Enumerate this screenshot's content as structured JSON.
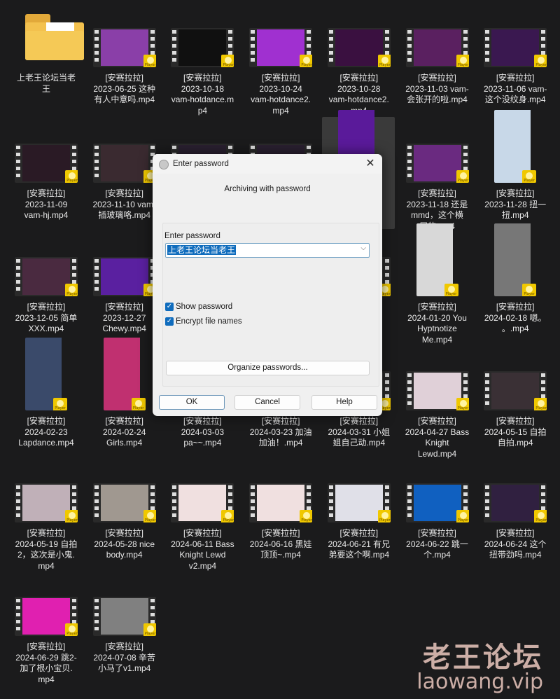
{
  "explorer": {
    "items": [
      {
        "type": "folder",
        "lines": [
          "上老王论坛当老",
          "王"
        ]
      },
      {
        "type": "video",
        "lines": [
          "[安赛拉拉]",
          "2023-06-25 这种",
          "有人中意吗.mp4"
        ],
        "color": "#8a3fa8"
      },
      {
        "type": "video",
        "lines": [
          "[安赛拉拉]",
          "2023-10-18",
          "vam-hotdance.m",
          "p4"
        ],
        "color": "#101010"
      },
      {
        "type": "video",
        "lines": [
          "[安赛拉拉]",
          "2023-10-24",
          "vam-hotdance2.",
          "mp4"
        ],
        "color": "#a030d0"
      },
      {
        "type": "video",
        "lines": [
          "[安赛拉拉]",
          "2023-10-28",
          "vam-hotdance2.",
          "mp4"
        ],
        "color": "#3a1040"
      },
      {
        "type": "video",
        "lines": [
          "[安赛拉拉]",
          "2023-11-03 vam-",
          "会张开的啦.mp4"
        ],
        "color": "#5a2060"
      },
      {
        "type": "video",
        "lines": [
          "[安赛拉拉]",
          "2023-11-06 vam-",
          "这个没纹身.mp4"
        ],
        "color": "#3a1850"
      },
      {
        "type": "video",
        "lines": [
          "[安赛拉拉]",
          "2023-11-09",
          "vam-hj.mp4"
        ],
        "color": "#2a1a25"
      },
      {
        "type": "video",
        "lines": [
          "[安赛拉拉]",
          "2023-11-10 vam-",
          "插玻璃咯.mp4"
        ],
        "color": "#3a2a30"
      },
      {
        "type": "video",
        "lines": [],
        "color": "#2a2030"
      },
      {
        "type": "video",
        "lines": [],
        "color": "#2a2030"
      },
      {
        "type": "video",
        "lines": [
          "",
          "",
          "on"
        ],
        "color": "#5a1a9a",
        "portrait": true,
        "selected": true
      },
      {
        "type": "video",
        "lines": [
          "[安赛拉拉]",
          "2023-11-18 还是",
          "mmd，这个横",
          "屏的.mp4"
        ],
        "color": "#6a2a80"
      },
      {
        "type": "video",
        "lines": [
          "[安赛拉拉]",
          "2023-11-28 扭一",
          "扭.mp4"
        ],
        "color": "#c8d8e8",
        "portrait": true
      },
      {
        "type": "video",
        "lines": [
          "[安赛拉拉]",
          "2023-12-05 简单",
          "XXX.mp4"
        ],
        "color": "#4a2a40"
      },
      {
        "type": "video",
        "lines": [
          "[安赛拉拉]",
          "2023-12-27",
          "Chewy.mp4"
        ],
        "color": "#5a20a0"
      },
      {
        "type": "video",
        "lines": [],
        "color": "#2a2a2a"
      },
      {
        "type": "video",
        "lines": [],
        "color": "#2a2a2a"
      },
      {
        "type": "video",
        "lines": [
          "",
          "花"
        ],
        "color": "#2a2a2a"
      },
      {
        "type": "video",
        "lines": [
          "[安赛拉拉]",
          "2024-01-20 You",
          "Hyptnotize",
          "Me.mp4"
        ],
        "color": "#d8d8d8",
        "portrait": true
      },
      {
        "type": "video",
        "lines": [
          "[安赛拉拉]",
          "2024-02-18 嗯。",
          "。.mp4"
        ],
        "color": "#777777",
        "portrait": true
      },
      {
        "type": "video",
        "lines": [
          "[安赛拉拉]",
          "2024-02-23",
          "Lapdance.mp4"
        ],
        "color": "#3a4a6a",
        "portrait": true
      },
      {
        "type": "video",
        "lines": [
          "[安赛拉拉]",
          "2024-02-24",
          "Girls.mp4"
        ],
        "color": "#c03070",
        "portrait": true
      },
      {
        "type": "video",
        "lines": [
          "[安赛拉拉]",
          "2024-03-03",
          "pa~~.mp4"
        ],
        "color": "#3a3a3a"
      },
      {
        "type": "video",
        "lines": [
          "[安赛拉拉]",
          "2024-03-23 加油",
          "加油！.mp4"
        ],
        "color": "#3a3a3a"
      },
      {
        "type": "video",
        "lines": [
          "[安赛拉拉]",
          "2024-03-31 小姐",
          "姐自己动.mp4"
        ],
        "color": "#3a3a3a"
      },
      {
        "type": "video",
        "lines": [
          "[安赛拉拉]",
          "2024-04-27 Bass",
          "Knight",
          "Lewd.mp4"
        ],
        "color": "#e0d0d8"
      },
      {
        "type": "video",
        "lines": [
          "[安赛拉拉]",
          "2024-05-15 自拍",
          "自拍.mp4"
        ],
        "color": "#3a3035"
      },
      {
        "type": "video",
        "lines": [
          "[安赛拉拉]",
          "2024-05-19 自拍",
          "2，这次是小鬼.",
          "mp4"
        ],
        "color": "#c0b0b8"
      },
      {
        "type": "video",
        "lines": [
          "[安赛拉拉]",
          "2024-05-28 nice",
          "body.mp4"
        ],
        "color": "#a09890"
      },
      {
        "type": "video",
        "lines": [
          "[安赛拉拉]",
          "2024-06-11 Bass",
          "Knight Lewd",
          "v2.mp4"
        ],
        "color": "#f0e0e0"
      },
      {
        "type": "video",
        "lines": [
          "[安赛拉拉]",
          "2024-06-16 黑娃",
          "顶顶~.mp4"
        ],
        "color": "#f0e0e0"
      },
      {
        "type": "video",
        "lines": [
          "[安赛拉拉]",
          "2024-06-21 有兄",
          "弟要这个啊.mp4"
        ],
        "color": "#e0e0e8"
      },
      {
        "type": "video",
        "lines": [
          "[安赛拉拉]",
          "2024-06-22 跳一",
          "个.mp4"
        ],
        "color": "#1060c0"
      },
      {
        "type": "video",
        "lines": [
          "[安赛拉拉]",
          "2024-06-24 这个",
          "扭带劲吗.mp4"
        ],
        "color": "#302040"
      },
      {
        "type": "video",
        "lines": [
          "[安赛拉拉]",
          "2024-06-29 跳2-",
          "加了根小宝贝.",
          "mp4"
        ],
        "color": "#e020b0"
      },
      {
        "type": "video",
        "lines": [
          "[安赛拉拉]",
          "2024-07-08 辛苦",
          "小马了v1.mp4"
        ],
        "color": "#808080"
      }
    ],
    "badge_label": "Player"
  },
  "dialog": {
    "title": "Enter password",
    "subtitle": "Archiving with password",
    "password_label": "Enter password",
    "password_value": "上老王论坛当老王",
    "show_password": {
      "label": "Show password",
      "checked": true
    },
    "encrypt_names": {
      "label": "Encrypt file names",
      "checked": true
    },
    "organize_label": "Organize passwords...",
    "ok_label": "OK",
    "cancel_label": "Cancel",
    "help_label": "Help",
    "close_glyph": "✕",
    "dropdown_glyph": "⌵",
    "check_glyph": "✓"
  },
  "watermark": {
    "title": "老王论坛",
    "url": "laowang.vip"
  }
}
